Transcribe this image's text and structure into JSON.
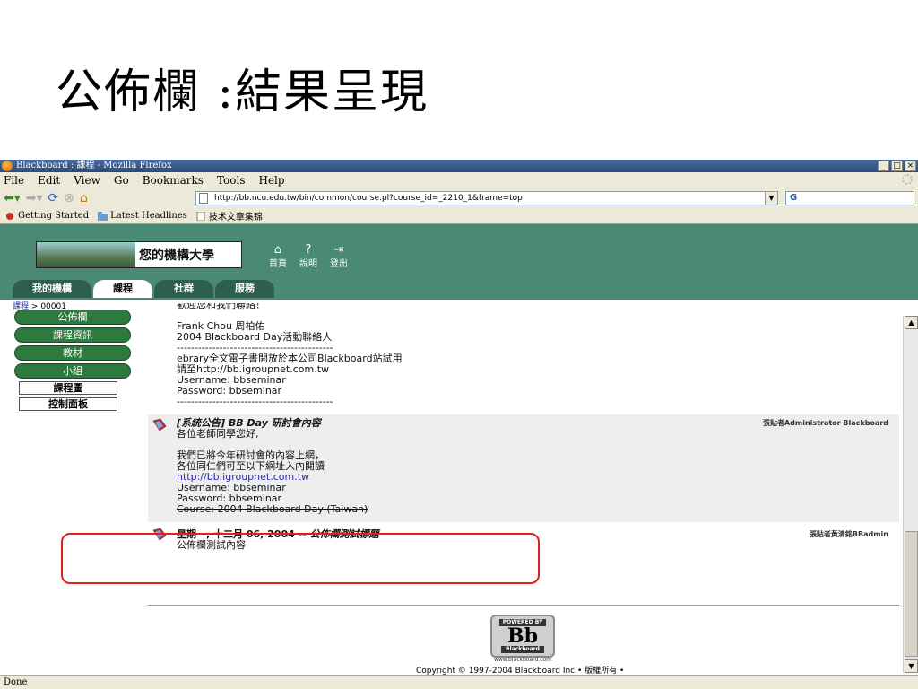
{
  "slide": {
    "title": "公佈欄 :結果呈現"
  },
  "window": {
    "title": "Blackboard : 課程 - Mozilla Firefox",
    "controls": [
      "_",
      "□",
      "×"
    ]
  },
  "menu": [
    "File",
    "Edit",
    "View",
    "Go",
    "Bookmarks",
    "Tools",
    "Help"
  ],
  "nav": {
    "url": "http://bb.ncu.edu.tw/bin/common/course.pl?course_id=_2210_1&frame=top",
    "search_placeholder": "G"
  },
  "bookmarks": [
    "Getting Started",
    "Latest Headlines",
    "技术文章集锦"
  ],
  "bb": {
    "logo_text": "您的機構大學",
    "top_links": [
      {
        "icon": "home-icon",
        "label": "首頁"
      },
      {
        "icon": "help-icon",
        "label": "說明"
      },
      {
        "icon": "logout-icon",
        "label": "登出"
      }
    ],
    "tabs": [
      "我的機構",
      "課程",
      "社群",
      "服務"
    ],
    "active_tab": "課程",
    "breadcrumb": {
      "link": "課程",
      "sep": ">",
      "current": "00001"
    }
  },
  "left_nav": {
    "pills": [
      "公佈欄",
      "課程資訊",
      "教材",
      "小組"
    ],
    "plain": [
      "課程圖",
      "控制面板"
    ]
  },
  "announcements": {
    "first": {
      "lines": [
        "歡迎您和我們聯絡！",
        "",
        "Frank Chou 周柏佑",
        "2004 Blackboard Day活動聯絡人",
        "--------------------------------------------",
        "ebrary全文電子書開放於本公司Blackboard站試用",
        "請至http://bb.igroupnet.com.tw",
        "Username: bbseminar",
        "Password: bbseminar",
        "--------------------------------------------"
      ]
    },
    "second": {
      "title": "[系統公告] BB Day 研討會內容",
      "poster": "張貼者Administrator Blackboard",
      "lines": [
        "各位老師同學您好,",
        "",
        "我們已將今年研討會的內容上網，",
        "各位同仁們可至以下網址入內閱讀"
      ],
      "link": "http://bb.igroupnet.com.tw",
      "lines2": [
        "Username: bbseminar",
        "Password: bbseminar"
      ],
      "course_line": "Course: 2004 Blackboard Day (Taiwan)"
    },
    "third": {
      "date": "星期一, 十二月 06, 2004",
      "separator": "--",
      "title": "公佈欄測試標題",
      "poster": "張貼者黃清銘BBadmin",
      "body": "公佈欄測試內容"
    }
  },
  "footer": {
    "badge_powered": "POWERED BY",
    "badge_logo": "Bb",
    "badge_name": "Blackboard",
    "badge_url": "www.blackboard.com",
    "copyright": "Copyright © 1997-2004 Blackboard Inc • 版權所有 •"
  },
  "status": "Done"
}
